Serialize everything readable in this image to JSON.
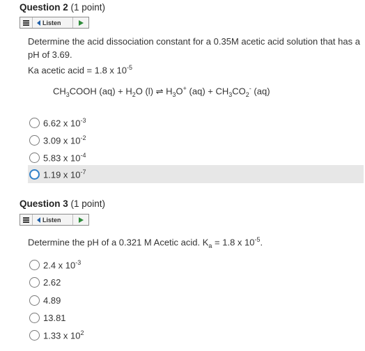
{
  "q2": {
    "title": "Question 2",
    "points": "(1 point)",
    "listen": "Listen",
    "text_line1": "Determine the acid dissociation constant for a 0.35M acetic acid solution that has a",
    "text_line2": "pH of 3.69.",
    "ka_label": "Ka acetic acid = 1.8 x 10",
    "ka_exp": "-5",
    "options": [
      {
        "base": "6.62 x 10",
        "exp": "-3"
      },
      {
        "base": "3.09 x 10",
        "exp": "-2"
      },
      {
        "base": "5.83 x 10",
        "exp": "-4"
      },
      {
        "base": "1.19 x 10",
        "exp": "-7"
      }
    ]
  },
  "q3": {
    "title": "Question 3",
    "points": "(1 point)",
    "listen": "Listen",
    "text_a": "Determine the pH of a 0.321 M Acetic acid. K",
    "text_sub": "a",
    "text_b": " = 1.8 x 10",
    "text_exp": "-5",
    "text_end": ".",
    "options": [
      {
        "base": "2.4 x 10",
        "exp": "-3"
      },
      {
        "base": "2.62",
        "exp": ""
      },
      {
        "base": "4.89",
        "exp": ""
      },
      {
        "base": "13.81",
        "exp": ""
      },
      {
        "base": "1.33 x 10",
        "exp": "2"
      }
    ]
  },
  "equation": {
    "p1": "CH",
    "s1": "3",
    "p2": "COOH (aq) + H",
    "s2": "2",
    "p3": "O (l) ⇌ H",
    "s3": "3",
    "p4": "O",
    "sp4": "+",
    "p5": " (aq) + CH",
    "s5": "3",
    "p6": "CO",
    "s6": "2",
    "sp6": "-",
    "p7": " (aq)"
  }
}
